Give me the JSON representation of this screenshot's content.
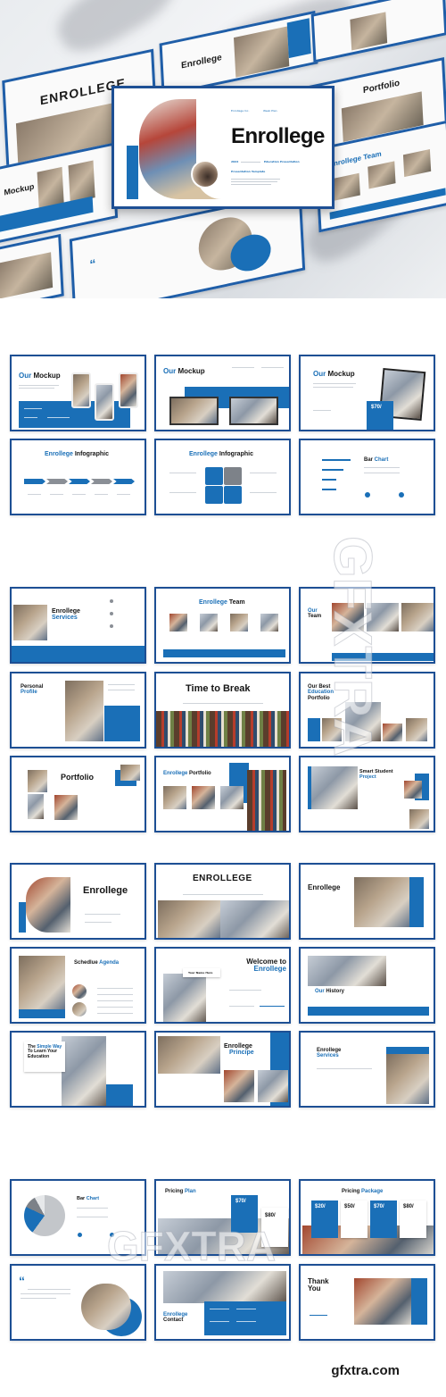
{
  "hero": {
    "title": "Enrollege",
    "meta_left": "Enrollege Inc.",
    "meta_right": "Week Plan",
    "year": "2022",
    "tagline": "Education Presentation",
    "subtitle": "Presentation Template",
    "bg_slides": [
      "ENROLLEGE",
      "Enrollege",
      "Portfolio",
      "Enrollege Team",
      "Mockup"
    ]
  },
  "theme": {
    "accent": "#1a6fb7",
    "border": "#1d4f94",
    "text": "#151515"
  },
  "sections": [
    {
      "slides": [
        {
          "title_accent": "Our",
          "title_rest": " Mockup",
          "kind": "phones"
        },
        {
          "title_accent": "Our",
          "title_rest": " Mockup",
          "kind": "laptops"
        },
        {
          "title_accent": "Our",
          "title_rest": " Mockup",
          "kind": "tablet",
          "price": "$70/"
        },
        {
          "title_accent": "Enrollege",
          "title_rest": " Infographic",
          "kind": "arrows"
        },
        {
          "title_accent": "Enrollege",
          "title_rest": " Infographic",
          "kind": "puzzle"
        },
        {
          "title_accent": "Bar",
          "title_rest": " Chart",
          "kind": "bars",
          "accent_first": false
        }
      ]
    },
    {
      "slides": [
        {
          "title_rest": "Enrollege",
          "title_accent": "Services",
          "kind": "services"
        },
        {
          "title_accent": "Enrollege",
          "title_rest": " Team",
          "kind": "team4"
        },
        {
          "title_accent": "Our",
          "title_rest": "Team",
          "kind": "team3"
        },
        {
          "title_rest": "Personal",
          "title_accent": "Profile",
          "kind": "profile"
        },
        {
          "title_rest": "Time to Break",
          "title_accent": "",
          "kind": "break"
        },
        {
          "title_rest": "Our Best",
          "title_accent": "Education",
          "title_rest2": "Portfolio",
          "kind": "bestportfolio"
        },
        {
          "title_rest": "Portfolio",
          "title_accent": "",
          "kind": "portfolio"
        },
        {
          "title_accent": "Enrollege",
          "title_rest": " Portfolio",
          "kind": "portfolio2"
        },
        {
          "title_rest": "Smart Student",
          "title_accent": "Project",
          "kind": "smart"
        }
      ]
    },
    {
      "slides": [
        {
          "title_rest": "Enrollege",
          "title_accent": "",
          "kind": "cover"
        },
        {
          "title_rest": "ENROLLEGE",
          "title_accent": "",
          "kind": "cover2"
        },
        {
          "title_rest": "Enrollege",
          "title_accent": "",
          "kind": "cover3"
        },
        {
          "title_rest": "Schedlue",
          "title_accent": "Agenda",
          "kind": "agenda"
        },
        {
          "title_rest": "Welcome to",
          "title_accent": "Enrollege",
          "kind": "welcome",
          "name_tag": "Your Name Here"
        },
        {
          "title_accent": "Our",
          "title_rest": " History",
          "kind": "history"
        },
        {
          "title_rest": "The",
          "title_accent": "Simple Way",
          "title_rest2": "To Learn Your Education",
          "kind": "simple"
        },
        {
          "title_rest": "Enrollege",
          "title_accent": "Principe",
          "kind": "principe"
        },
        {
          "title_rest": "Enrollege",
          "title_accent": "Services",
          "kind": "services2"
        }
      ]
    },
    {
      "slides": [
        {
          "title_rest": "Bar",
          "title_accent": "Chart",
          "kind": "pie"
        },
        {
          "title_rest": "Pricing",
          "title_accent": "Plan",
          "kind": "pricing",
          "prices": [
            "$70/",
            "$80/"
          ]
        },
        {
          "title_rest": "Pricing",
          "title_accent": "Package",
          "kind": "package",
          "prices": [
            "$20/",
            "$50/",
            "$70/",
            "$80/"
          ]
        },
        {
          "title_rest": "",
          "title_accent": "",
          "kind": "quote",
          "quote_mark": "“"
        },
        {
          "title_accent": "Enrollege",
          "title_rest": "Contact",
          "kind": "contact"
        },
        {
          "title_rest": "Thank You",
          "title_accent": "",
          "kind": "thanks"
        }
      ]
    }
  ],
  "watermark": {
    "site": "gfxtra.com",
    "overlay": "GFXTRA"
  }
}
